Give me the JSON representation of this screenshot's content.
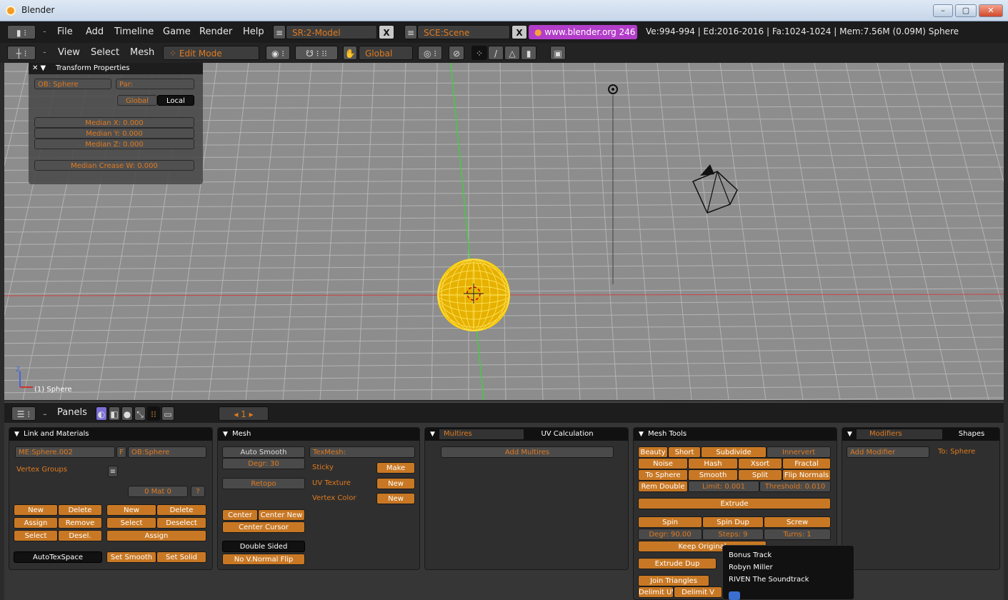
{
  "window": {
    "title": "Blender",
    "controls": [
      "–",
      "▢",
      "✕"
    ]
  },
  "menu": {
    "items": [
      "File",
      "Add",
      "Timeline",
      "Game",
      "Render",
      "Help"
    ],
    "screen": "SR:2-Model",
    "scene": "SCE:Scene",
    "url": "www.blender.org 246",
    "stats": "Ve:994-994 | Ed:2016-2016 | Fa:1024-1024 | Mem:7.56M (0.09M) Sphere"
  },
  "viewheader": {
    "items": [
      "View",
      "Select",
      "Mesh"
    ],
    "mode": "Edit Mode",
    "orientation": "Global"
  },
  "transform": {
    "title": "Transform Properties",
    "ob_name": "OB: Sphere",
    "par": "Par:",
    "global": "Global",
    "local": "Local",
    "median_x": "Median X: 0.000",
    "median_y": "Median Y: 0.000",
    "median_z": "Median Z: 0.000",
    "crease": "Median Crease W: 0.000"
  },
  "viewport": {
    "object_label": "(1) Sphere",
    "axis_label": "Z"
  },
  "buttons_header": {
    "panels_label": "Panels",
    "frame": "1"
  },
  "link_materials": {
    "title": "Link and Materials",
    "me_name": "ME:Sphere.002",
    "f_label": "F",
    "ob_name": "OB:Sphere",
    "vertex_groups": "Vertex Groups",
    "mat_field": "0 Mat 0",
    "question": "?",
    "left_btns": [
      "New",
      "Delete",
      "Assign",
      "Remove",
      "Select",
      "Desel."
    ],
    "right_btns": [
      "New",
      "Delete",
      "Select",
      "Deselect",
      "Assign"
    ],
    "autotex": "AutoTexSpace",
    "set_smooth": "Set Smooth",
    "set_solid": "Set Solid"
  },
  "mesh_panel": {
    "title": "Mesh",
    "auto_smooth": "Auto Smooth",
    "degr": "Degr: 30",
    "retopo": "Retopo",
    "texmesh": "TexMesh:",
    "sticky": "Sticky",
    "make": "Make",
    "uv_texture": "UV Texture",
    "new1": "New",
    "vertex_color": "Vertex Color",
    "new2": "New",
    "center": "Center",
    "center_new": "Center New",
    "center_cursor": "Center Cursor",
    "double_sided": "Double Sided",
    "no_vnormal": "No V.Normal Flip"
  },
  "multires": {
    "tab1": "Multires",
    "tab2": "UV Calculation",
    "add": "Add Multires"
  },
  "mesh_tools": {
    "title": "Mesh Tools",
    "row1": [
      "Beauty",
      "Short",
      "Subdivide",
      "Innervert"
    ],
    "row2": [
      "Noise",
      "Hash",
      "Xsort",
      "Fractal"
    ],
    "row3": [
      "To Sphere",
      "Smooth",
      "Split",
      "Flip Normals"
    ],
    "rem_double": "Rem Double",
    "limit": "Limit: 0.001",
    "threshold": "Threshold: 0.010",
    "extrude": "Extrude",
    "spin": "Spin",
    "spin_dup": "Spin Dup",
    "screw": "Screw",
    "degr": "Degr: 90.00",
    "steps": "Steps: 9",
    "turns": "Turns: 1",
    "keep_original": "Keep Original",
    "extrude_dup": "Extrude Dup",
    "join_triangles": "Join Triangles",
    "delimit_uvs": "Delimit UVs",
    "delimit_v": "Delimit V"
  },
  "modifiers": {
    "tab1": "Modifiers",
    "tab2": "Shapes",
    "add": "Add Modifier",
    "to": "To: Sphere"
  },
  "tooltip": {
    "line1": "Bonus Track",
    "line2": "Robyn Miller",
    "line3": "RIVEN The Soundtrack"
  }
}
